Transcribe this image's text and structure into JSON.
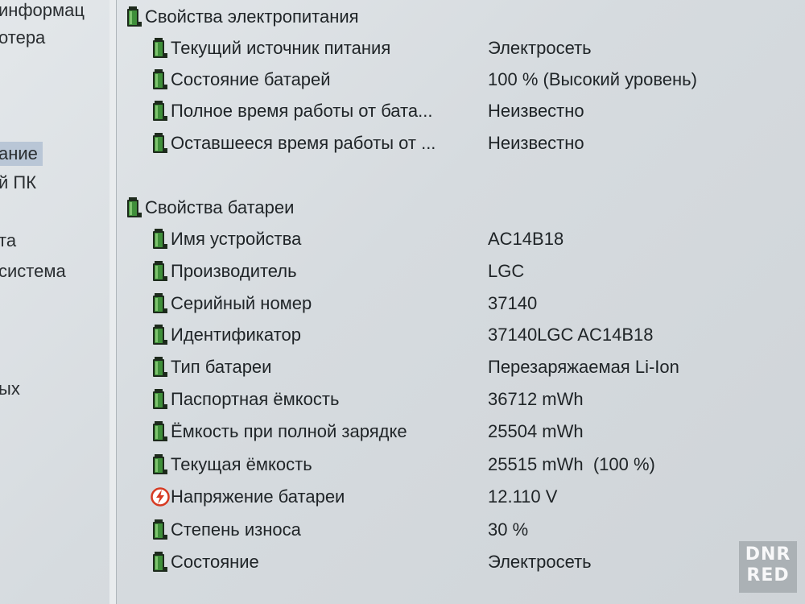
{
  "nav": {
    "items": [
      {
        "label": "информац",
        "selected": false
      },
      {
        "label": "отера",
        "selected": false
      },
      {
        "label": "ание",
        "selected": true
      },
      {
        "label": "й ПК",
        "selected": false
      },
      {
        "label": "та",
        "selected": false
      },
      {
        "label": "система",
        "selected": false
      },
      {
        "label": "ых",
        "selected": false
      }
    ]
  },
  "sections": [
    {
      "title": "Свойства электропитания",
      "rows": [
        {
          "field": "Текущий источник питания",
          "value": "Электросеть",
          "icon": "battery-icon"
        },
        {
          "field": "Состояние батарей",
          "value": "100 % (Высокий уровень)",
          "icon": "battery-icon"
        },
        {
          "field": "Полное время работы от бата...",
          "value": "Неизвестно",
          "icon": "battery-icon"
        },
        {
          "field": "Оставшееся время работы от ...",
          "value": "Неизвестно",
          "icon": "battery-icon"
        }
      ]
    },
    {
      "title": "Свойства батареи",
      "rows": [
        {
          "field": "Имя устройства",
          "value": "AC14B18",
          "icon": "battery-icon"
        },
        {
          "field": "Производитель",
          "value": "LGC",
          "icon": "battery-icon"
        },
        {
          "field": "Серийный номер",
          "value": "37140",
          "icon": "battery-icon"
        },
        {
          "field": "Идентификатор",
          "value": "37140LGC AC14B18",
          "icon": "battery-icon"
        },
        {
          "field": "Тип батареи",
          "value": "Перезаряжаемая Li-Ion",
          "icon": "battery-icon"
        },
        {
          "field": "Паспортная ёмкость",
          "value": "36712 mWh",
          "icon": "battery-icon"
        },
        {
          "field": "Ёмкость при полной зарядке",
          "value": "25504 mWh",
          "icon": "battery-icon"
        },
        {
          "field": "Текущая ёмкость",
          "value": "25515 mWh  (100 %)",
          "icon": "battery-icon"
        },
        {
          "field": "Напряжение батареи",
          "value": "12.110 V",
          "icon": "voltage-icon"
        },
        {
          "field": "Степень износа",
          "value": "30 %",
          "icon": "battery-icon"
        },
        {
          "field": "Состояние",
          "value": "Электросеть",
          "icon": "battery-icon"
        }
      ]
    }
  ],
  "watermark": {
    "line1": "DNR",
    "line2": "RED"
  },
  "colors": {
    "battery_green": "#3f8f3a",
    "battery_dark": "#1d2a1c",
    "voltage_red": "#d63a22",
    "selection": "#b9c6d6"
  }
}
